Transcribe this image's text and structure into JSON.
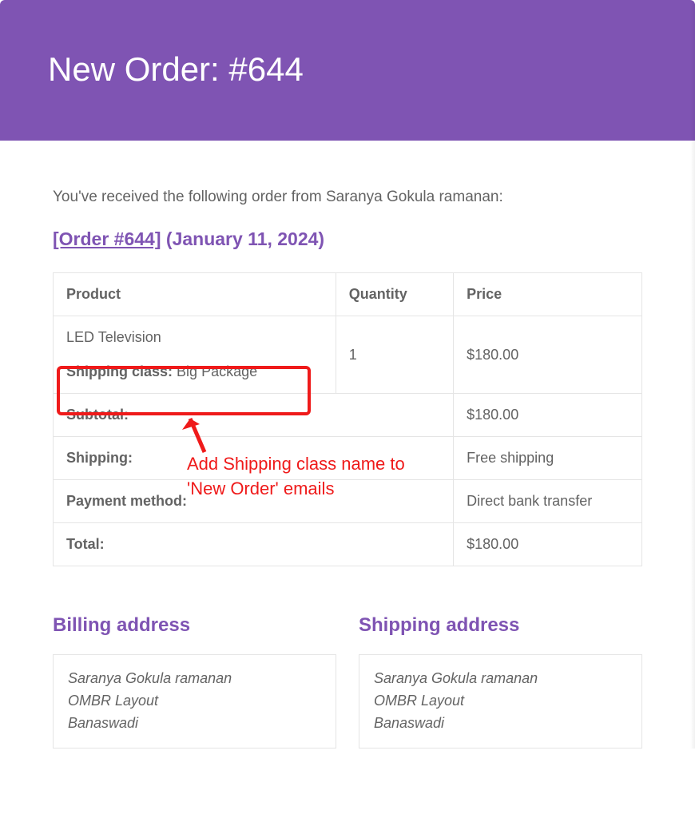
{
  "header": {
    "title": "New Order: #644"
  },
  "intro": "You've received the following order from Saranya Gokula ramanan:",
  "order_link_text": "[Order #644]",
  "order_date_text": "(January 11, 2024)",
  "table": {
    "headers": {
      "product": "Product",
      "quantity": "Quantity",
      "price": "Price"
    },
    "items": [
      {
        "name": "LED Television",
        "shipping_class_label": "Shipping class:",
        "shipping_class_value": "Big Package",
        "quantity": "1",
        "price": "$180.00"
      }
    ],
    "totals": {
      "subtotal_label": "Subtotal:",
      "subtotal_value": "$180.00",
      "shipping_label": "Shipping:",
      "shipping_value": "Free shipping",
      "payment_label": "Payment method:",
      "payment_value": "Direct bank transfer",
      "total_label": "Total:",
      "total_value": "$180.00"
    }
  },
  "annotation": {
    "line1": "Add Shipping class name to",
    "line2": "'New Order' emails"
  },
  "addresses": {
    "billing": {
      "heading": "Billing address",
      "line1": "Saranya Gokula ramanan",
      "line2": "OMBR Layout",
      "line3": "Banaswadi"
    },
    "shipping": {
      "heading": "Shipping address",
      "line1": "Saranya Gokula ramanan",
      "line2": "OMBR Layout",
      "line3": "Banaswadi"
    }
  }
}
